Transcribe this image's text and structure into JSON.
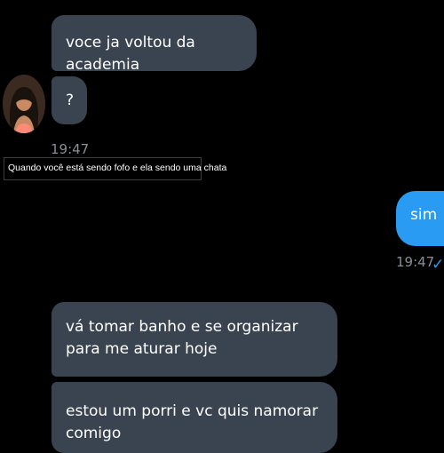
{
  "messages": {
    "incoming_1": "voce ja voltou da academia",
    "incoming_2": "?",
    "incoming_time": "19:47",
    "outgoing_1": "sim",
    "outgoing_time": "19:47",
    "read_receipt": "✓",
    "incoming_3": "vá tomar banho e se organizar para me aturar hoje",
    "incoming_4": "estou um porri e vc quis namorar comigo"
  },
  "caption": {
    "text": "Quando você está sendo fofo e ela sendo uma chata"
  },
  "colors": {
    "background": "#000000",
    "incoming_bubble": "#3a4450",
    "outgoing_bubble": "#2a9bf2",
    "timestamp": "#8a8f96"
  },
  "icons": {
    "avatar": "contact-avatar",
    "read_receipt": "check-icon"
  }
}
